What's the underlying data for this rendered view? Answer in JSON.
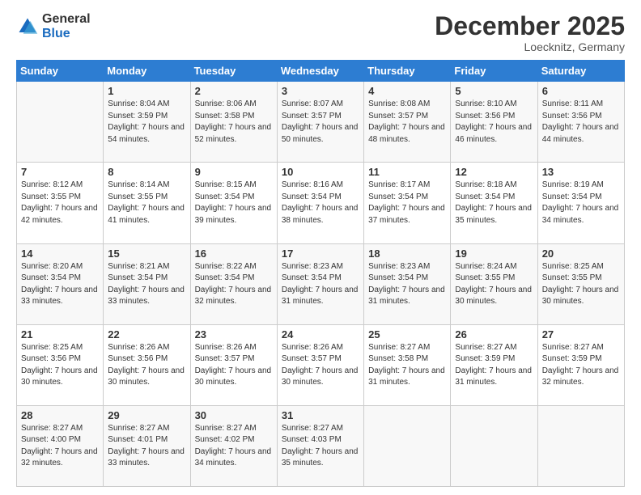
{
  "header": {
    "logo_general": "General",
    "logo_blue": "Blue",
    "month_title": "December 2025",
    "location": "Loecknitz, Germany"
  },
  "days": {
    "headers": [
      "Sunday",
      "Monday",
      "Tuesday",
      "Wednesday",
      "Thursday",
      "Friday",
      "Saturday"
    ]
  },
  "weeks": [
    [
      {
        "day": "",
        "sunrise": "",
        "sunset": "",
        "daylight": ""
      },
      {
        "day": "1",
        "sunrise": "Sunrise: 8:04 AM",
        "sunset": "Sunset: 3:59 PM",
        "daylight": "Daylight: 7 hours and 54 minutes."
      },
      {
        "day": "2",
        "sunrise": "Sunrise: 8:06 AM",
        "sunset": "Sunset: 3:58 PM",
        "daylight": "Daylight: 7 hours and 52 minutes."
      },
      {
        "day": "3",
        "sunrise": "Sunrise: 8:07 AM",
        "sunset": "Sunset: 3:57 PM",
        "daylight": "Daylight: 7 hours and 50 minutes."
      },
      {
        "day": "4",
        "sunrise": "Sunrise: 8:08 AM",
        "sunset": "Sunset: 3:57 PM",
        "daylight": "Daylight: 7 hours and 48 minutes."
      },
      {
        "day": "5",
        "sunrise": "Sunrise: 8:10 AM",
        "sunset": "Sunset: 3:56 PM",
        "daylight": "Daylight: 7 hours and 46 minutes."
      },
      {
        "day": "6",
        "sunrise": "Sunrise: 8:11 AM",
        "sunset": "Sunset: 3:56 PM",
        "daylight": "Daylight: 7 hours and 44 minutes."
      }
    ],
    [
      {
        "day": "7",
        "sunrise": "Sunrise: 8:12 AM",
        "sunset": "Sunset: 3:55 PM",
        "daylight": "Daylight: 7 hours and 42 minutes."
      },
      {
        "day": "8",
        "sunrise": "Sunrise: 8:14 AM",
        "sunset": "Sunset: 3:55 PM",
        "daylight": "Daylight: 7 hours and 41 minutes."
      },
      {
        "day": "9",
        "sunrise": "Sunrise: 8:15 AM",
        "sunset": "Sunset: 3:54 PM",
        "daylight": "Daylight: 7 hours and 39 minutes."
      },
      {
        "day": "10",
        "sunrise": "Sunrise: 8:16 AM",
        "sunset": "Sunset: 3:54 PM",
        "daylight": "Daylight: 7 hours and 38 minutes."
      },
      {
        "day": "11",
        "sunrise": "Sunrise: 8:17 AM",
        "sunset": "Sunset: 3:54 PM",
        "daylight": "Daylight: 7 hours and 37 minutes."
      },
      {
        "day": "12",
        "sunrise": "Sunrise: 8:18 AM",
        "sunset": "Sunset: 3:54 PM",
        "daylight": "Daylight: 7 hours and 35 minutes."
      },
      {
        "day": "13",
        "sunrise": "Sunrise: 8:19 AM",
        "sunset": "Sunset: 3:54 PM",
        "daylight": "Daylight: 7 hours and 34 minutes."
      }
    ],
    [
      {
        "day": "14",
        "sunrise": "Sunrise: 8:20 AM",
        "sunset": "Sunset: 3:54 PM",
        "daylight": "Daylight: 7 hours and 33 minutes."
      },
      {
        "day": "15",
        "sunrise": "Sunrise: 8:21 AM",
        "sunset": "Sunset: 3:54 PM",
        "daylight": "Daylight: 7 hours and 33 minutes."
      },
      {
        "day": "16",
        "sunrise": "Sunrise: 8:22 AM",
        "sunset": "Sunset: 3:54 PM",
        "daylight": "Daylight: 7 hours and 32 minutes."
      },
      {
        "day": "17",
        "sunrise": "Sunrise: 8:23 AM",
        "sunset": "Sunset: 3:54 PM",
        "daylight": "Daylight: 7 hours and 31 minutes."
      },
      {
        "day": "18",
        "sunrise": "Sunrise: 8:23 AM",
        "sunset": "Sunset: 3:54 PM",
        "daylight": "Daylight: 7 hours and 31 minutes."
      },
      {
        "day": "19",
        "sunrise": "Sunrise: 8:24 AM",
        "sunset": "Sunset: 3:55 PM",
        "daylight": "Daylight: 7 hours and 30 minutes."
      },
      {
        "day": "20",
        "sunrise": "Sunrise: 8:25 AM",
        "sunset": "Sunset: 3:55 PM",
        "daylight": "Daylight: 7 hours and 30 minutes."
      }
    ],
    [
      {
        "day": "21",
        "sunrise": "Sunrise: 8:25 AM",
        "sunset": "Sunset: 3:56 PM",
        "daylight": "Daylight: 7 hours and 30 minutes."
      },
      {
        "day": "22",
        "sunrise": "Sunrise: 8:26 AM",
        "sunset": "Sunset: 3:56 PM",
        "daylight": "Daylight: 7 hours and 30 minutes."
      },
      {
        "day": "23",
        "sunrise": "Sunrise: 8:26 AM",
        "sunset": "Sunset: 3:57 PM",
        "daylight": "Daylight: 7 hours and 30 minutes."
      },
      {
        "day": "24",
        "sunrise": "Sunrise: 8:26 AM",
        "sunset": "Sunset: 3:57 PM",
        "daylight": "Daylight: 7 hours and 30 minutes."
      },
      {
        "day": "25",
        "sunrise": "Sunrise: 8:27 AM",
        "sunset": "Sunset: 3:58 PM",
        "daylight": "Daylight: 7 hours and 31 minutes."
      },
      {
        "day": "26",
        "sunrise": "Sunrise: 8:27 AM",
        "sunset": "Sunset: 3:59 PM",
        "daylight": "Daylight: 7 hours and 31 minutes."
      },
      {
        "day": "27",
        "sunrise": "Sunrise: 8:27 AM",
        "sunset": "Sunset: 3:59 PM",
        "daylight": "Daylight: 7 hours and 32 minutes."
      }
    ],
    [
      {
        "day": "28",
        "sunrise": "Sunrise: 8:27 AM",
        "sunset": "Sunset: 4:00 PM",
        "daylight": "Daylight: 7 hours and 32 minutes."
      },
      {
        "day": "29",
        "sunrise": "Sunrise: 8:27 AM",
        "sunset": "Sunset: 4:01 PM",
        "daylight": "Daylight: 7 hours and 33 minutes."
      },
      {
        "day": "30",
        "sunrise": "Sunrise: 8:27 AM",
        "sunset": "Sunset: 4:02 PM",
        "daylight": "Daylight: 7 hours and 34 minutes."
      },
      {
        "day": "31",
        "sunrise": "Sunrise: 8:27 AM",
        "sunset": "Sunset: 4:03 PM",
        "daylight": "Daylight: 7 hours and 35 minutes."
      },
      {
        "day": "",
        "sunrise": "",
        "sunset": "",
        "daylight": ""
      },
      {
        "day": "",
        "sunrise": "",
        "sunset": "",
        "daylight": ""
      },
      {
        "day": "",
        "sunrise": "",
        "sunset": "",
        "daylight": ""
      }
    ]
  ]
}
